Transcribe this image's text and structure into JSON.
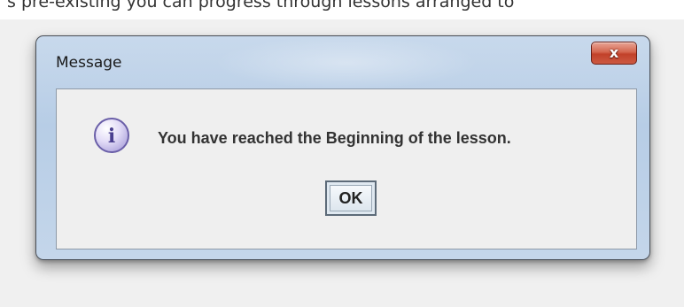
{
  "background_text": "s pre-existing you can progress through lessons arranged to",
  "dialog": {
    "title": "Message",
    "close_glyph": "x",
    "icon": "info-icon",
    "icon_glyph": "i",
    "message": "You have reached the Beginning of the lesson.",
    "ok_label": "OK"
  },
  "colors": {
    "close_button": "#c2412a",
    "info_icon_fill": "#d9d3f2",
    "info_icon_stroke": "#6a5fa8"
  }
}
